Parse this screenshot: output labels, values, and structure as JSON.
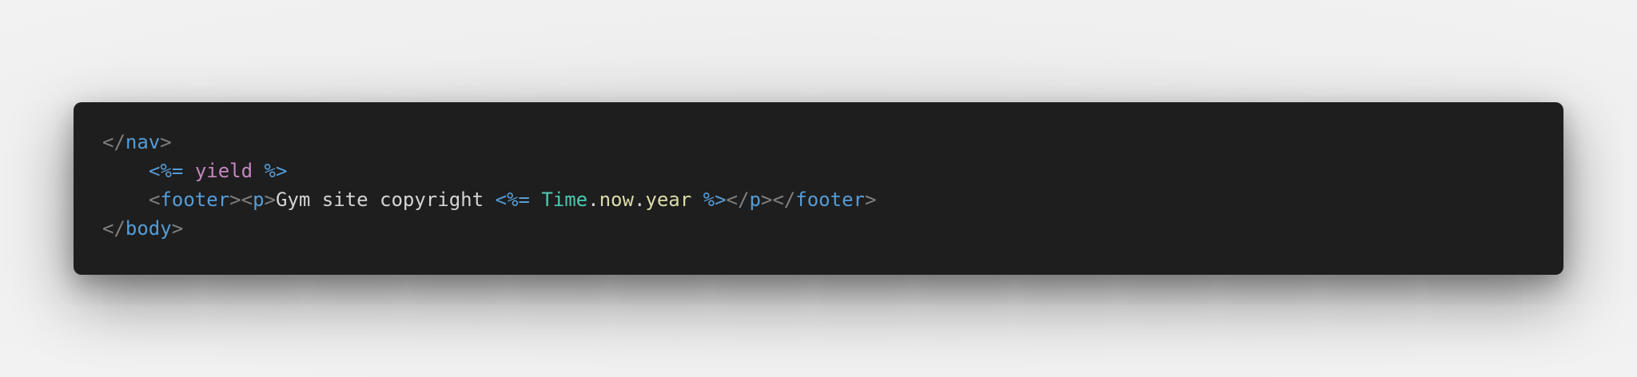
{
  "code": {
    "line1": {
      "open": "</",
      "tag": "nav",
      "close": ">"
    },
    "line2": {
      "erb_open": "<%=",
      "keyword": "yield",
      "erb_close": "%>"
    },
    "line3": {
      "footer_open_lt": "<",
      "footer_tag": "footer",
      "footer_open_gt": ">",
      "p_open_lt": "<",
      "p_tag": "p",
      "p_open_gt": ">",
      "text": "Gym site copyright ",
      "erb_open": "<%=",
      "const": "Time",
      "dot1": ".",
      "method1": "now",
      "dot2": ".",
      "method2": "year",
      "erb_close": "%>",
      "p_close_lt": "</",
      "p_close_tag": "p",
      "p_close_gt": ">",
      "footer_close_lt": "</",
      "footer_close_tag": "footer",
      "footer_close_gt": ">"
    },
    "line4": {
      "open": "</",
      "tag": "body",
      "close": ">"
    }
  }
}
